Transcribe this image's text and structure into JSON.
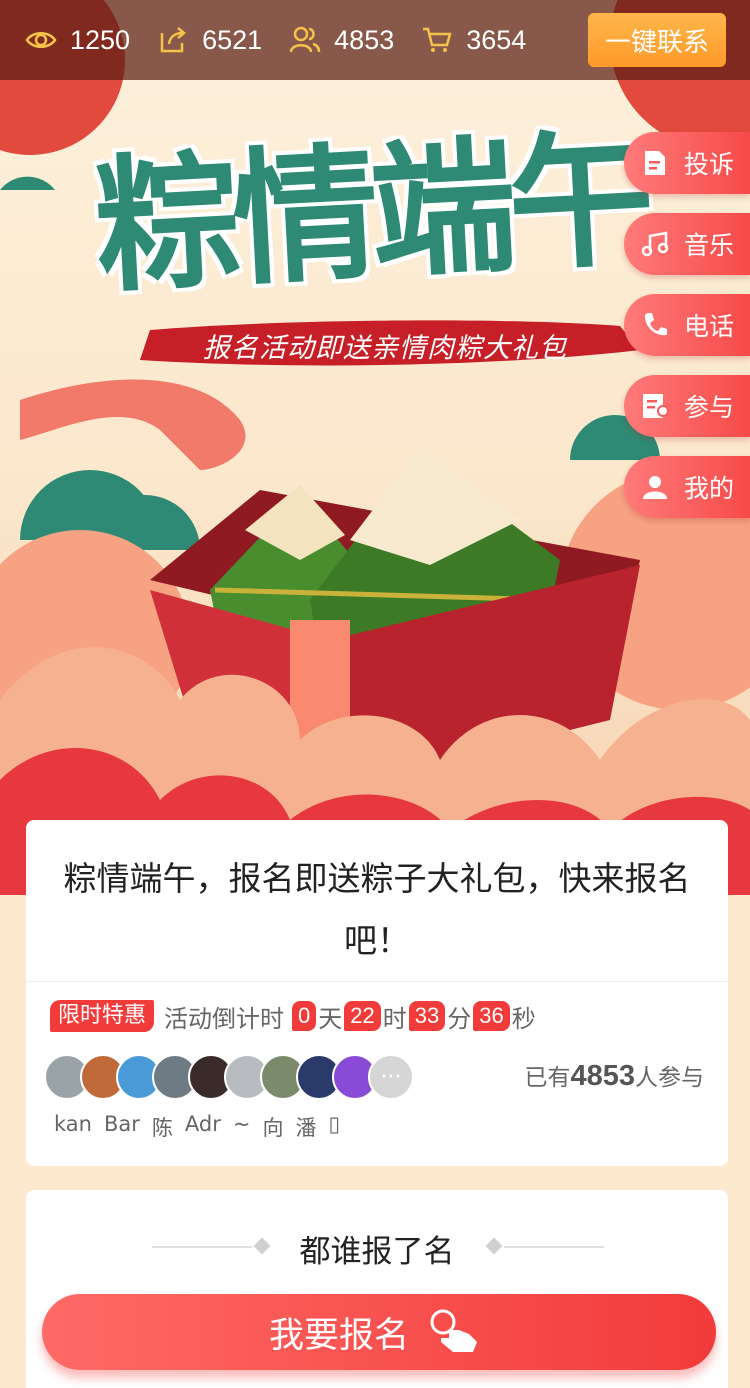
{
  "stats": [
    {
      "icon": "eye-icon",
      "value": "1250"
    },
    {
      "icon": "share-icon",
      "value": "6521"
    },
    {
      "icon": "users-icon",
      "value": "4853"
    },
    {
      "icon": "cart-icon",
      "value": "3654"
    }
  ],
  "contact_button": "一键联系",
  "hero": {
    "title": "粽情端午",
    "slogan": "报名活动即送亲情肉粽大礼包"
  },
  "side_menu": [
    {
      "icon": "complaint-icon",
      "label": "投诉"
    },
    {
      "icon": "music-icon",
      "label": "音乐"
    },
    {
      "icon": "phone-icon",
      "label": "电话"
    },
    {
      "icon": "participate-icon",
      "label": "参与"
    },
    {
      "icon": "user-icon",
      "label": "我的"
    }
  ],
  "activity": {
    "headline": "粽情端午，报名即送粽子大礼包，快来报名吧！",
    "badge": "限时特惠",
    "countdown_label": "活动倒计时",
    "countdown": {
      "days": "0",
      "days_unit": "天",
      "hours": "22",
      "hours_unit": "时",
      "minutes": "33",
      "minutes_unit": "分",
      "seconds": "36",
      "seconds_unit": "秒"
    },
    "joined_prefix": "已有",
    "joined_count": "4853",
    "joined_suffix": "人参与",
    "more": "···",
    "participant_names": [
      "kan",
      "Bar",
      "陈",
      "Adr",
      "~",
      "向",
      "潘",
      "▯"
    ]
  },
  "signup_section": {
    "title": "都谁报了名"
  },
  "signup_button": "我要报名",
  "colors": {
    "accent": "#f23b3b",
    "contact": "#ff9a2a",
    "teal": "#2e8a74"
  }
}
